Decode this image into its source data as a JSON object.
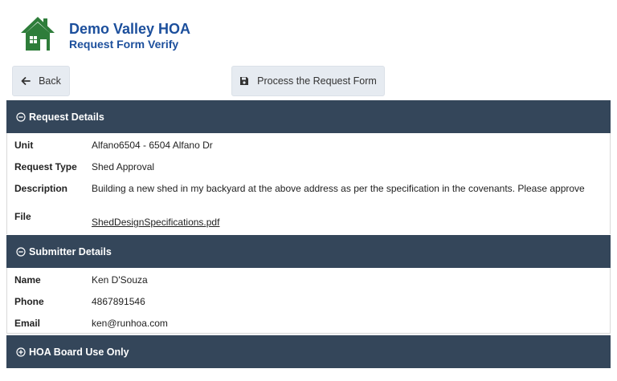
{
  "header": {
    "title": "Demo Valley HOA",
    "subtitle": "Request Form Verify",
    "logo_icon": "house-icon",
    "logo_color": "#2e7d3a"
  },
  "toolbar": {
    "back_label": "Back",
    "process_label": "Process the Request Form"
  },
  "request_details": {
    "heading": "Request Details",
    "unit_label": "Unit",
    "unit_value": "Alfano6504 - 6504 Alfano Dr",
    "type_label": "Request Type",
    "type_value": "Shed Approval",
    "description_label": "Description",
    "description_value": "Building a new shed in my backyard at the above address as per the specification in the covenants. Please approve",
    "file_label": "File",
    "file_value": "ShedDesignSpecifications.pdf"
  },
  "submitter_details": {
    "heading": "Submitter Details",
    "name_label": "Name",
    "name_value": "Ken D'Souza",
    "phone_label": "Phone",
    "phone_value": "4867891546",
    "email_label": "Email",
    "email_value": "ken@runhoa.com"
  },
  "board": {
    "heading": "HOA Board Use Only"
  },
  "colors": {
    "panel_header": "#34465a",
    "title": "#1c4f9c",
    "button_bg": "#e6ebf1"
  }
}
